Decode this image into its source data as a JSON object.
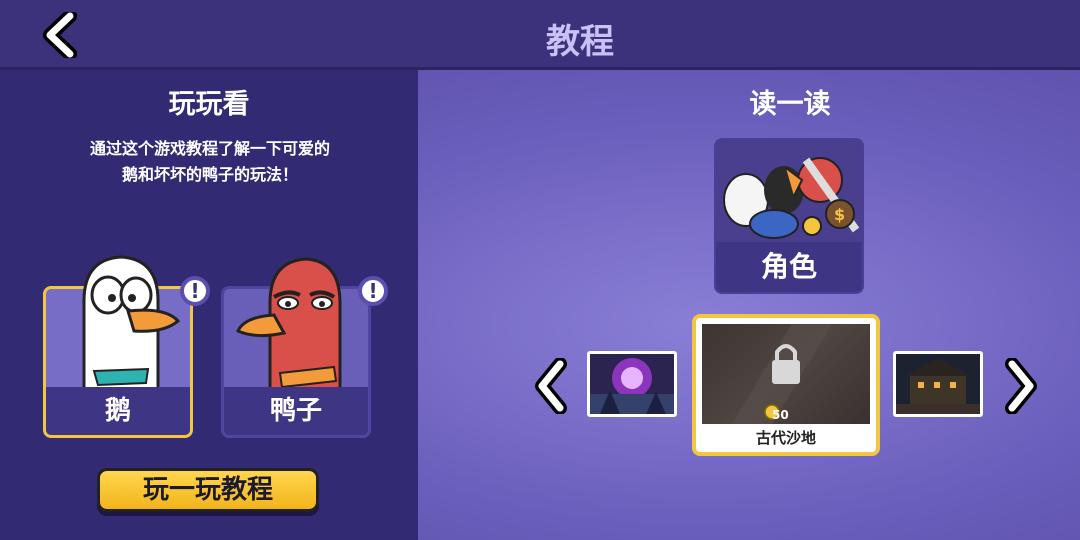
{
  "header": {
    "title": "教程"
  },
  "left": {
    "title": "玩玩看",
    "description_line1": "通过这个游戏教程了解一下可爱的",
    "description_line2": "鹅和坏坏的鸭子的玩法！",
    "characters": [
      {
        "label": "鹅",
        "alert": "!"
      },
      {
        "label": "鸭子",
        "alert": "!"
      }
    ],
    "play_button": "玩一玩教程"
  },
  "right": {
    "title": "读一读",
    "role_card": {
      "label": "角色"
    },
    "map_selected": {
      "name": "古代沙地",
      "cost": "50"
    }
  },
  "colors": {
    "accent": "#f4c53e",
    "panel": "#332a74",
    "topbar": "#3b327b"
  }
}
